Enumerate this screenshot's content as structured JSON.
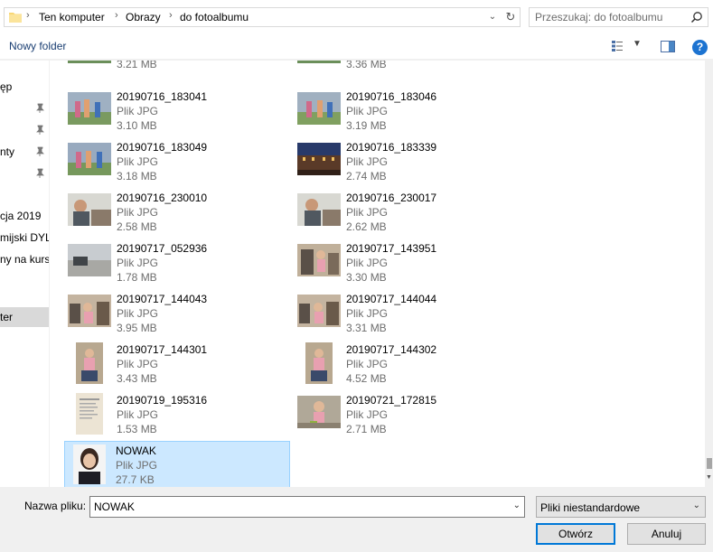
{
  "address": {
    "breadcrumbs": [
      "Ten komputer",
      "Obrazy",
      "do fotoalbumu"
    ],
    "separator": "›"
  },
  "search": {
    "placeholder": "Przeszukaj: do fotoalbumu"
  },
  "toolbar": {
    "new_folder": "Nowy folder",
    "help": "?"
  },
  "nav": {
    "items": [
      {
        "label": "ęp",
        "pinned": false
      },
      {
        "label": "",
        "pinned": true
      },
      {
        "label": "",
        "pinned": true
      },
      {
        "label": "nty",
        "pinned": true
      },
      {
        "label": "",
        "pinned": true
      },
      {
        "label": "cja 2019",
        "pinned": false
      },
      {
        "label": "mijski DYL",
        "pinned": false
      },
      {
        "label": "ny na kurs",
        "pinned": false
      },
      {
        "label": "",
        "pinned": false
      },
      {
        "label": "ter",
        "pinned": false,
        "selected": true
      }
    ]
  },
  "files": [
    {
      "name": "",
      "type": "Plik JPG",
      "size": "3.21 MB"
    },
    {
      "name": "",
      "type": "Plik JPG",
      "size": "3.36 MB"
    },
    {
      "name": "20190716_183041",
      "type": "Plik JPG",
      "size": "3.10 MB"
    },
    {
      "name": "20190716_183046",
      "type": "Plik JPG",
      "size": "3.19 MB"
    },
    {
      "name": "20190716_183049",
      "type": "Plik JPG",
      "size": "3.18 MB"
    },
    {
      "name": "20190716_183339",
      "type": "Plik JPG",
      "size": "2.74 MB"
    },
    {
      "name": "20190716_230010",
      "type": "Plik JPG",
      "size": "2.58 MB"
    },
    {
      "name": "20190716_230017",
      "type": "Plik JPG",
      "size": "2.62 MB"
    },
    {
      "name": "20190717_052936",
      "type": "Plik JPG",
      "size": "1.78 MB"
    },
    {
      "name": "20190717_143951",
      "type": "Plik JPG",
      "size": "3.30 MB"
    },
    {
      "name": "20190717_144043",
      "type": "Plik JPG",
      "size": "3.95 MB"
    },
    {
      "name": "20190717_144044",
      "type": "Plik JPG",
      "size": "3.31 MB"
    },
    {
      "name": "20190717_144301",
      "type": "Plik JPG",
      "size": "3.43 MB"
    },
    {
      "name": "20190717_144302",
      "type": "Plik JPG",
      "size": "4.52 MB"
    },
    {
      "name": "20190719_195316",
      "type": "Plik JPG",
      "size": "1.53 MB"
    },
    {
      "name": "20190721_172815",
      "type": "Plik JPG",
      "size": "2.71 MB"
    },
    {
      "name": "NOWAK",
      "type": "Plik JPG",
      "size": "27.7 KB",
      "selected": true
    }
  ],
  "filename": {
    "label": "Nazwa pliku:",
    "value": "NOWAK"
  },
  "filetype": {
    "value": "Pliki niestandardowe"
  },
  "buttons": {
    "open": "Otwórz",
    "cancel": "Anuluj"
  },
  "colors": {
    "accent": "#0078d7",
    "selection": "#cce8ff",
    "link": "#1a3e72"
  }
}
